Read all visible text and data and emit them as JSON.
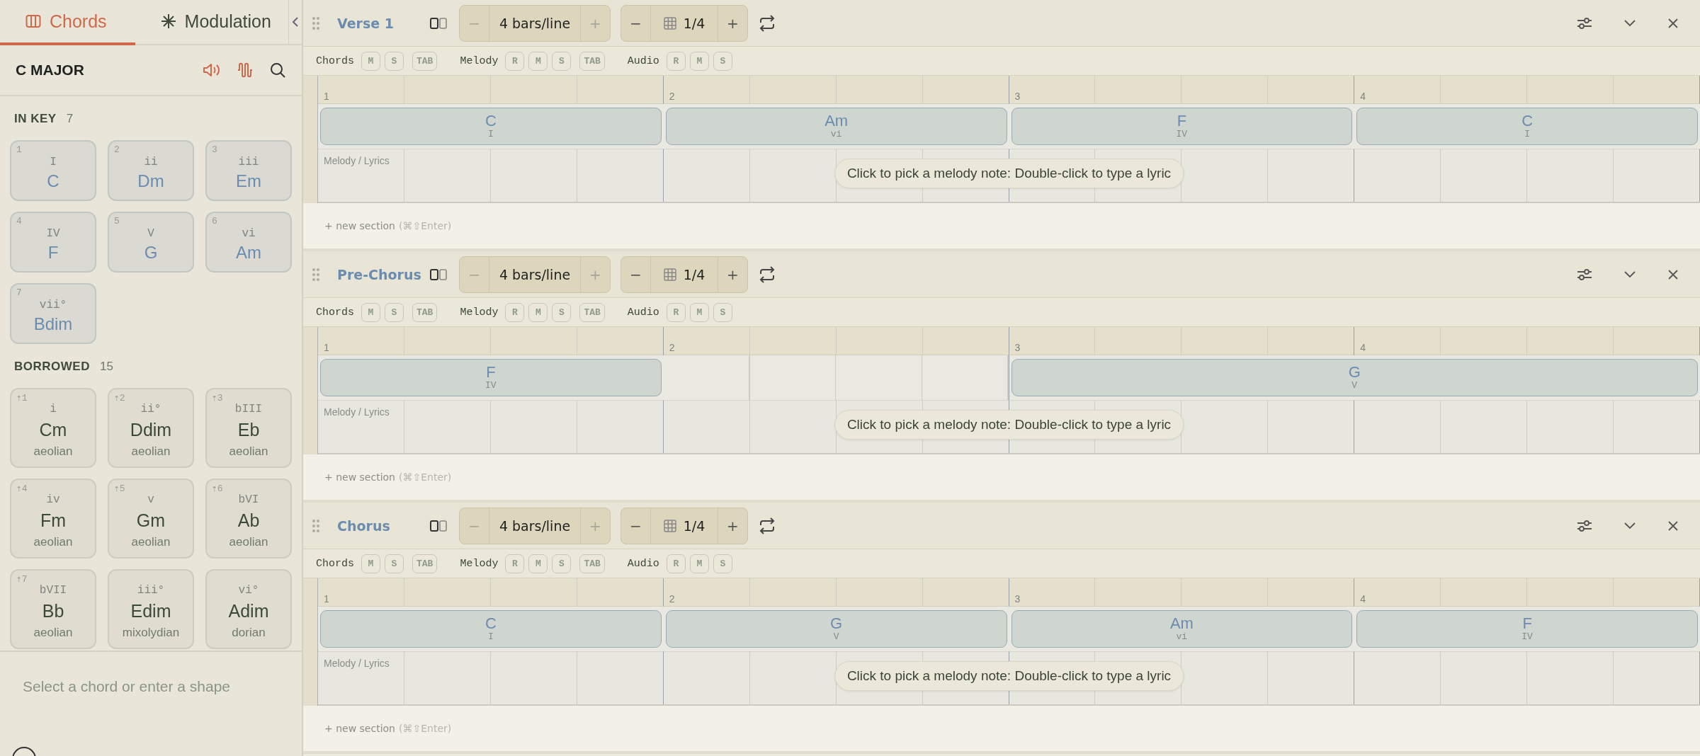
{
  "sidebar": {
    "tabs": [
      {
        "label": "Chords",
        "selected": true
      },
      {
        "label": "Modulation",
        "selected": false
      }
    ],
    "key": "C MAJOR",
    "groups": [
      {
        "title": "IN KEY",
        "count": "7",
        "kind": "in_key",
        "chords": [
          {
            "index": "1",
            "numeral": "I",
            "name": "C"
          },
          {
            "index": "2",
            "numeral": "ii",
            "name": "Dm"
          },
          {
            "index": "3",
            "numeral": "iii",
            "name": "Em"
          },
          {
            "index": "4",
            "numeral": "IV",
            "name": "F"
          },
          {
            "index": "5",
            "numeral": "V",
            "name": "G"
          },
          {
            "index": "6",
            "numeral": "vi",
            "name": "Am"
          },
          {
            "index": "7",
            "numeral": "vii°",
            "name": "Bdim"
          }
        ]
      },
      {
        "title": "BORROWED",
        "count": "15",
        "kind": "borrowed",
        "chords": [
          {
            "index": "⇡1",
            "numeral": "i",
            "name": "Cm",
            "mode": "aeolian"
          },
          {
            "index": "⇡2",
            "numeral": "ii°",
            "name": "Ddim",
            "mode": "aeolian"
          },
          {
            "index": "⇡3",
            "numeral": "bIII",
            "name": "Eb",
            "mode": "aeolian"
          },
          {
            "index": "⇡4",
            "numeral": "iv",
            "name": "Fm",
            "mode": "aeolian"
          },
          {
            "index": "⇡5",
            "numeral": "v",
            "name": "Gm",
            "mode": "aeolian"
          },
          {
            "index": "⇡6",
            "numeral": "bVI",
            "name": "Ab",
            "mode": "aeolian"
          },
          {
            "index": "⇡7",
            "numeral": "bVII",
            "name": "Bb",
            "mode": "aeolian"
          },
          {
            "numeral": "iii°",
            "name": "Edim",
            "mode": "mixolydian"
          },
          {
            "numeral": "vi°",
            "name": "Adim",
            "mode": "dorian"
          }
        ]
      }
    ],
    "input": {
      "placeholder": "Select a chord or enter a shape"
    }
  },
  "sections": [
    {
      "title": "Verse 1",
      "minus": "−",
      "plus": "+",
      "bars_per_line": "4 bars/line",
      "grid": "1/4",
      "bar_numbers": [
        "1",
        "2",
        "3",
        "4"
      ],
      "tracks": [
        {
          "label": "Chords",
          "buttons": [
            "M",
            "S",
            "TAB"
          ]
        },
        {
          "label": "Melody",
          "buttons": [
            "R",
            "M",
            "S",
            "TAB"
          ]
        },
        {
          "label": "Audio",
          "buttons": [
            "R",
            "M",
            "S"
          ]
        }
      ],
      "slots": [
        {
          "kind": "chord",
          "name": "C",
          "numeral": "I"
        },
        {
          "kind": "chord",
          "name": "Am",
          "numeral": "vi"
        },
        {
          "kind": "chord",
          "name": "F",
          "numeral": "IV"
        },
        {
          "kind": "chord",
          "name": "C",
          "numeral": "I"
        }
      ],
      "melody_label": "Melody / Lyrics",
      "hint": "Click to pick a melody note: Double-click to type a lyric",
      "new_section": "+ new section",
      "shortcut": "(⌘⇧Enter)"
    },
    {
      "title": "Pre-Chorus",
      "minus": "−",
      "plus": "+",
      "bars_per_line": "4 bars/line",
      "grid": "1/4",
      "bar_numbers": [
        "1",
        "2",
        "3",
        "4"
      ],
      "tracks": [
        {
          "label": "Chords",
          "buttons": [
            "M",
            "S",
            "TAB"
          ]
        },
        {
          "label": "Melody",
          "buttons": [
            "R",
            "M",
            "S",
            "TAB"
          ]
        },
        {
          "label": "Audio",
          "buttons": [
            "R",
            "M",
            "S"
          ]
        }
      ],
      "slots": [
        {
          "kind": "chord",
          "name": "F",
          "numeral": "IV"
        },
        {
          "kind": "empty"
        },
        {
          "kind": "chord",
          "name": "G",
          "numeral": "V"
        },
        {
          "kind": "hold"
        }
      ],
      "melody_label": "Melody / Lyrics",
      "hint": "Click to pick a melody note: Double-click to type a lyric",
      "new_section": "+ new section",
      "shortcut": "(⌘⇧Enter)"
    },
    {
      "title": "Chorus",
      "minus": "−",
      "plus": "+",
      "bars_per_line": "4 bars/line",
      "grid": "1/4",
      "bar_numbers": [
        "1",
        "2",
        "3",
        "4"
      ],
      "tracks": [
        {
          "label": "Chords",
          "buttons": [
            "M",
            "S",
            "TAB"
          ]
        },
        {
          "label": "Melody",
          "buttons": [
            "R",
            "M",
            "S",
            "TAB"
          ]
        },
        {
          "label": "Audio",
          "buttons": [
            "R",
            "M",
            "S"
          ]
        }
      ],
      "slots": [
        {
          "kind": "chord",
          "name": "C",
          "numeral": "I"
        },
        {
          "kind": "chord",
          "name": "G",
          "numeral": "V"
        },
        {
          "kind": "chord",
          "name": "Am",
          "numeral": "vi"
        },
        {
          "kind": "chord",
          "name": "F",
          "numeral": "IV"
        }
      ],
      "melody_label": "Melody / Lyrics",
      "hint": "Click to pick a melody note: Double-click to type a lyric",
      "new_section": "+ new section",
      "shortcut": "(⌘⇧Enter)"
    }
  ]
}
